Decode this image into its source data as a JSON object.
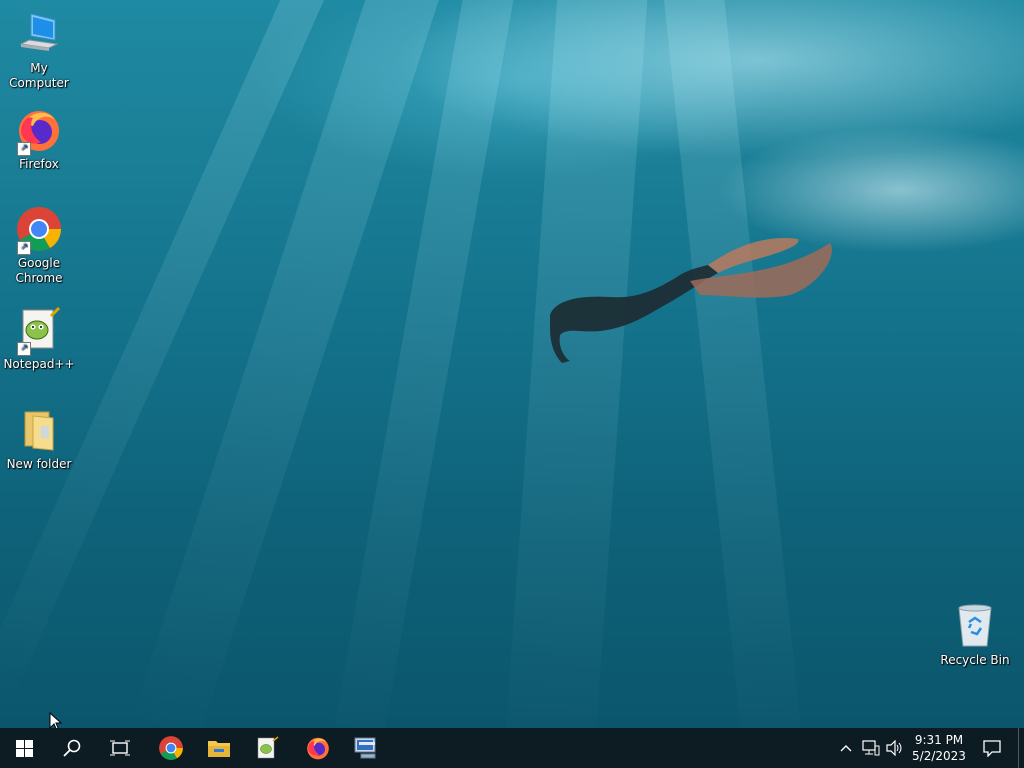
{
  "desktop": {
    "icons": [
      {
        "label": "My Computer",
        "icon": "computer-icon"
      },
      {
        "label": "Firefox",
        "icon": "firefox-icon"
      },
      {
        "label": "Google Chrome",
        "icon": "chrome-icon"
      },
      {
        "label": "Notepad++",
        "icon": "notepadpp-icon"
      },
      {
        "label": "New folder",
        "icon": "folder-icon"
      }
    ],
    "recycle_bin": {
      "label": "Recycle Bin",
      "icon": "recycle-bin-icon"
    }
  },
  "taskbar": {
    "pinned": [
      "start-icon",
      "search-icon",
      "task-view-icon",
      "chrome-icon",
      "file-explorer-icon",
      "notepadpp-icon",
      "firefox-icon",
      "remote-desktop-icon"
    ],
    "tray_icons": [
      "chevron-up-icon",
      "network-icon",
      "volume-icon"
    ],
    "clock": {
      "time": "9:31 PM",
      "date": "5/2/2023"
    },
    "notification_icon": "notification-icon"
  },
  "colors": {
    "taskbar": "#0d1b22",
    "water": "#137089"
  }
}
